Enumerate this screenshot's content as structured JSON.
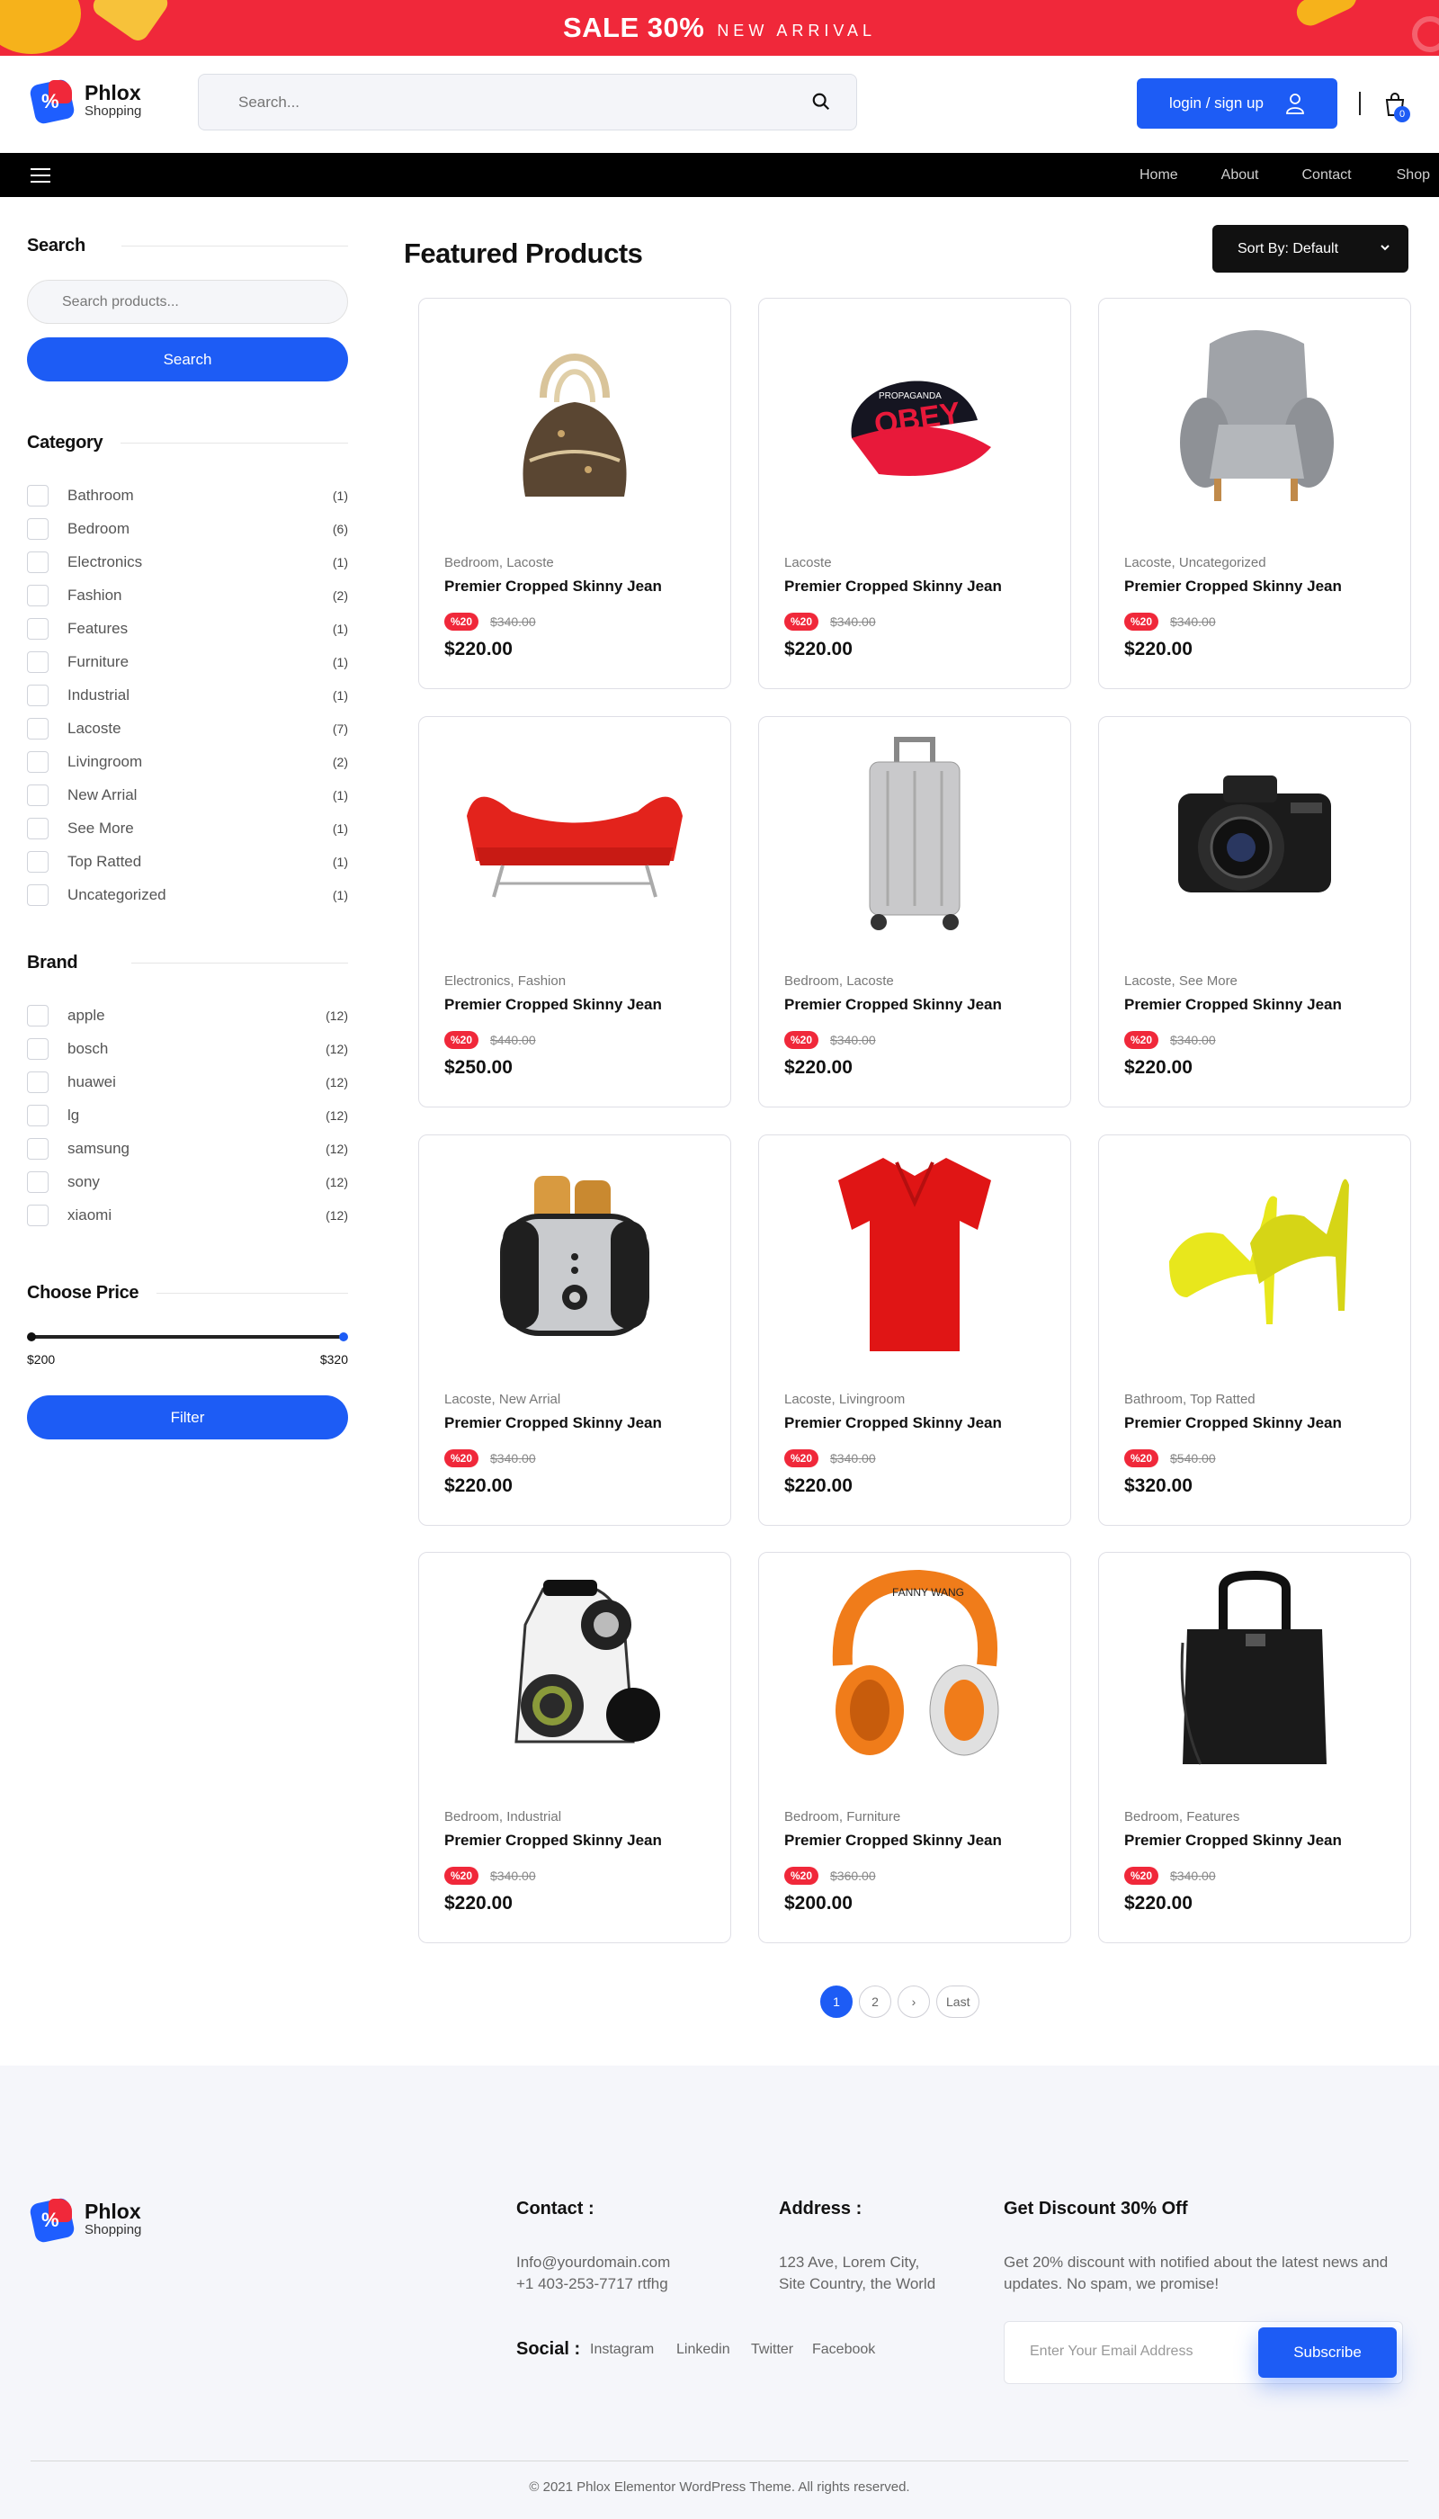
{
  "promo": {
    "sale": "SALE 30%",
    "arrival": "NEW ARRIVAL"
  },
  "brand": {
    "name": "Phlox",
    "tagline": "Shopping",
    "badge": "%"
  },
  "header": {
    "search_placeholder": "Search...",
    "login_label": "login / sign up",
    "cart_count": "0"
  },
  "nav": {
    "links": [
      "Home",
      "About",
      "Contact",
      "Shop"
    ]
  },
  "sidebar": {
    "search_title": "Search",
    "search_placeholder": "Search products...",
    "search_button": "Search",
    "category_title": "Category",
    "categories": [
      {
        "label": "Bathroom",
        "count": "(1)"
      },
      {
        "label": "Bedroom",
        "count": "(6)"
      },
      {
        "label": "Electronics",
        "count": "(1)"
      },
      {
        "label": "Fashion",
        "count": "(2)"
      },
      {
        "label": "Features",
        "count": "(1)"
      },
      {
        "label": "Furniture",
        "count": "(1)"
      },
      {
        "label": "Industrial",
        "count": "(1)"
      },
      {
        "label": "Lacoste",
        "count": "(7)"
      },
      {
        "label": "Livingroom",
        "count": "(2)"
      },
      {
        "label": "New Arrial",
        "count": "(1)"
      },
      {
        "label": "See More",
        "count": "(1)"
      },
      {
        "label": "Top Ratted",
        "count": "(1)"
      },
      {
        "label": "Uncategorized",
        "count": "(1)"
      }
    ],
    "brand_title": "Brand",
    "brands": [
      {
        "label": "apple",
        "count": "(12)"
      },
      {
        "label": "bosch",
        "count": "(12)"
      },
      {
        "label": "huawei",
        "count": "(12)"
      },
      {
        "label": "lg",
        "count": "(12)"
      },
      {
        "label": "samsung",
        "count": "(12)"
      },
      {
        "label": "sony",
        "count": "(12)"
      },
      {
        "label": "xiaomi",
        "count": "(12)"
      }
    ],
    "price_title": "Choose Price",
    "price_min": "$200",
    "price_max": "$320",
    "filter_button": "Filter"
  },
  "main": {
    "title": "Featured Products",
    "sort_label": "Sort By: Default"
  },
  "products": [
    {
      "image": "handbag-icon",
      "cats": "Bedroom, Lacoste",
      "name": "Premier Cropped Skinny Jean",
      "discount": "%20",
      "old_price": "$340.00",
      "price": "$220.00"
    },
    {
      "image": "cap-icon",
      "cats": "Lacoste",
      "name": "Premier Cropped Skinny Jean",
      "discount": "%20",
      "old_price": "$340.00",
      "price": "$220.00"
    },
    {
      "image": "armchair-icon",
      "cats": "Lacoste, Uncategorized",
      "name": "Premier Cropped Skinny Jean",
      "discount": "%20",
      "old_price": "$340.00",
      "price": "$220.00"
    },
    {
      "image": "sofa-icon",
      "cats": "Electronics, Fashion",
      "name": "Premier Cropped Skinny Jean",
      "discount": "%20",
      "old_price": "$440.00",
      "price": "$250.00"
    },
    {
      "image": "suitcase-icon",
      "cats": "Bedroom, Lacoste",
      "name": "Premier Cropped Skinny Jean",
      "discount": "%20",
      "old_price": "$340.00",
      "price": "$220.00"
    },
    {
      "image": "camera-icon",
      "cats": "Lacoste, See More",
      "name": "Premier Cropped Skinny Jean",
      "discount": "%20",
      "old_price": "$340.00",
      "price": "$220.00"
    },
    {
      "image": "toaster-icon",
      "cats": "Lacoste, New Arrial",
      "name": "Premier Cropped Skinny Jean",
      "discount": "%20",
      "old_price": "$340.00",
      "price": "$220.00"
    },
    {
      "image": "polo-shirt-icon",
      "cats": "Lacoste, Livingroom",
      "name": "Premier Cropped Skinny Jean",
      "discount": "%20",
      "old_price": "$340.00",
      "price": "$220.00"
    },
    {
      "image": "heels-icon",
      "cats": "Bathroom, Top Ratted",
      "name": "Premier Cropped Skinny Jean",
      "discount": "%20",
      "old_price": "$540.00",
      "price": "$320.00"
    },
    {
      "image": "vacuum-icon",
      "cats": "Bedroom, Industrial",
      "name": "Premier Cropped Skinny Jean",
      "discount": "%20",
      "old_price": "$340.00",
      "price": "$220.00"
    },
    {
      "image": "headphones-icon",
      "cats": "Bedroom, Furniture",
      "name": "Premier Cropped Skinny Jean",
      "discount": "%20",
      "old_price": "$360.00",
      "price": "$200.00"
    },
    {
      "image": "tote-bag-icon",
      "cats": "Bedroom, Features",
      "name": "Premier Cropped Skinny Jean",
      "discount": "%20",
      "old_price": "$340.00",
      "price": "$220.00"
    }
  ],
  "pagination": {
    "pages": [
      "1",
      "2"
    ],
    "next": "›",
    "last": "Last"
  },
  "footer": {
    "contact_title": "Contact :",
    "email": "Info@yourdomain.com",
    "phone": " +1 403-253-7717 rtfhg",
    "address_title": "Address :",
    "address1": "123 Ave, Lorem City,",
    "address2": "Site Country, the World",
    "social_title": "Social :",
    "social": [
      "Instagram",
      "Linkedin",
      "Twitter",
      "Facebook"
    ],
    "discount_title": "Get Discount 30% Off",
    "discount_text": "Get 20% discount with notified about the latest news and updates. No spam, we promise!",
    "email_placeholder": "Enter Your Email Address",
    "subscribe": "Subscribe",
    "copyright": "© 2021 Phlox Elementor WordPress Theme. All rights reserved."
  },
  "colors": {
    "accent": "#1d5cf5",
    "promo": "#f0283a",
    "navbar": "#000000"
  }
}
